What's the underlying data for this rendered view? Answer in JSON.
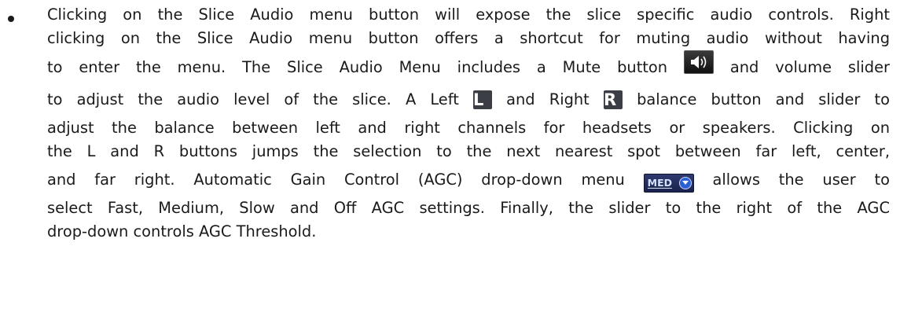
{
  "paragraph": {
    "lines": [
      "Clicking on the Slice Audio menu button will expose the slice specific audio controls. Right",
      "clicking on the Slice Audio menu button offers a shortcut for muting audio without having",
      "to enter the menu.  The Slice Audio Menu includes a Mute button",
      "and volume slider",
      "to adjust the audio level of the slice. A Left",
      "and Right",
      "balance button and slider to",
      "adjust the balance between left and right channels for headsets or speakers. Clicking on",
      "the L and R buttons jumps the selection to the next nearest spot between far left, center,",
      "and far right.  Automatic Gain Control (AGC) drop-down menu",
      "allows the user to",
      "select Fast, Medium, Slow and Off AGC settings. Finally, the slider to the right of the AGC",
      "drop-down controls AGC Threshold."
    ]
  },
  "icons": {
    "mute_button": "speaker-icon",
    "left_button_label": "L",
    "right_button_label": "R",
    "agc_dropdown_label": "MED"
  },
  "colors": {
    "text": "#1a1a1a",
    "icon_dark": "#3b3e45",
    "agc_blue": "#2f3a6e",
    "agc_arrow": "#2a5fd6"
  }
}
